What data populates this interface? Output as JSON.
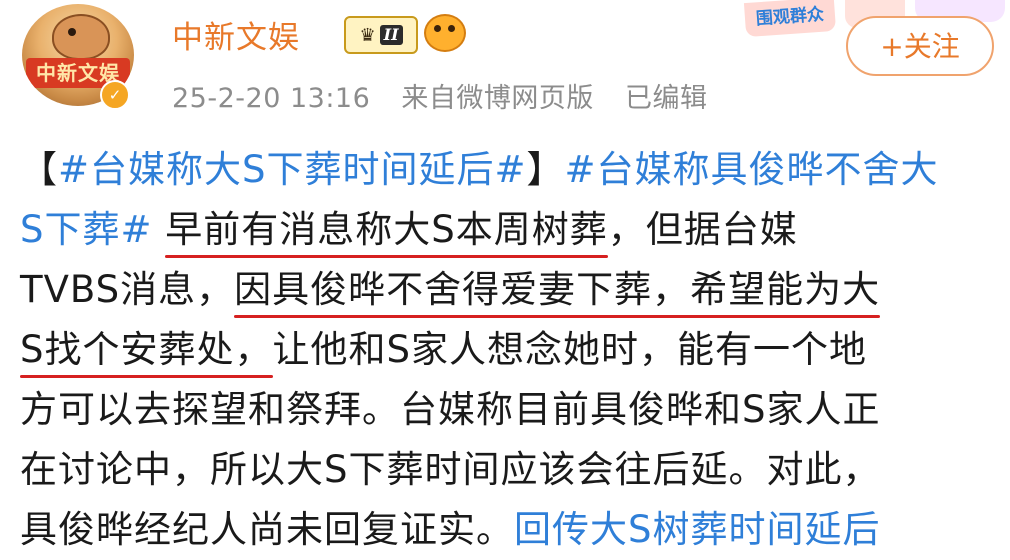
{
  "account": {
    "name": "中新文娱",
    "avatar_text": "中新文娱",
    "verified_mark": "✓",
    "level": "II",
    "timestamp": "25-2-20 13:16",
    "source": "来自微博网页版",
    "edited": "已编辑",
    "top_badge": "围观群众",
    "follow_label": "+关注"
  },
  "post": {
    "line1": {
      "a": "【",
      "tag1": "#台媒称大S下葬时间延后#",
      "b": "】",
      "tag2": "#台媒称具俊晔不舍大"
    },
    "line2": {
      "tag": "S下葬#",
      "sp": " ",
      "u": "早前有消息称大S本周树葬",
      "rest": "，但据台媒"
    },
    "line3": {
      "a": "TVBS消息，",
      "u": "因具俊晔不舍得爱妻下葬，希望能为大"
    },
    "line4": {
      "u": "S找个安葬处，",
      "rest": "让他和S家人想念她时，能有一个地"
    },
    "line5": "方可以去探望和祭拜。台媒称目前具俊晔和S家人正",
    "line6": "在讨论中，所以大S下葬时间应该会往后延。对此，",
    "line7": {
      "a": "具俊晔经纪人尚未回复证实。",
      "link": "回传大S树葬时间延后"
    }
  }
}
